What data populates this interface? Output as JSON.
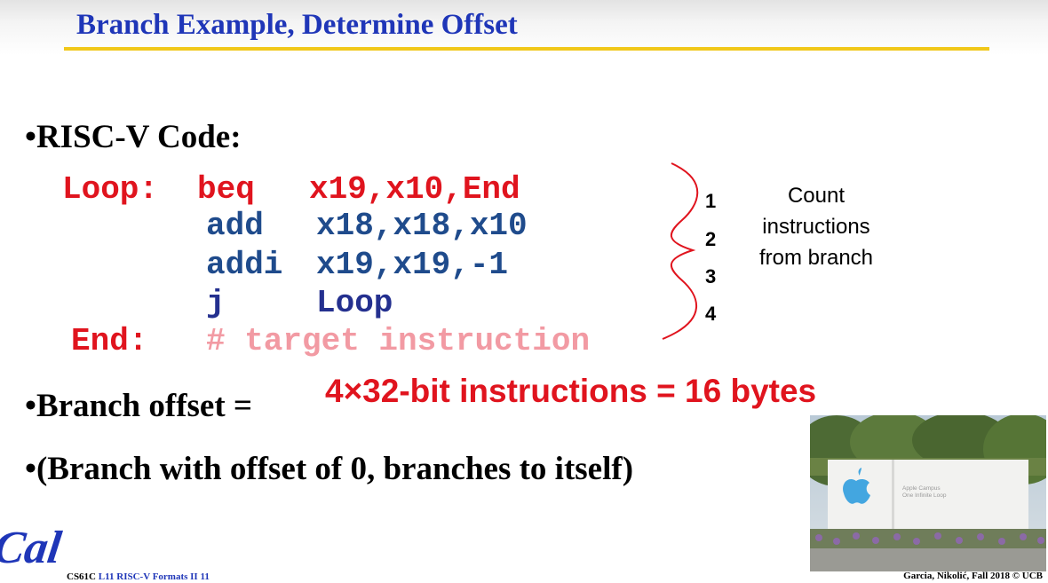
{
  "title": "Branch Example, Determine Offset",
  "bullets": {
    "code_heading": "•RISC-V Code:",
    "offset_label": "•Branch offset =",
    "zero_offset": "•(Branch with offset of 0, branches to itself)"
  },
  "code": {
    "line1_label": "Loop:",
    "line1_op": "beq",
    "line1_args": "x19,x10,End",
    "line2_op": "add",
    "line2_args": "x18,x18,x10",
    "line3_op": "addi",
    "line3_args": "x19,x19,-1",
    "line4_op": "j",
    "line4_args": "Loop",
    "line5_label": "End:",
    "line5_comment": "# target instruction"
  },
  "count_numbers": [
    "1",
    "2",
    "3",
    "4"
  ],
  "count_note": [
    "Count",
    "instructions",
    "from branch"
  ],
  "offset_value": "4×32-bit instructions = 16 bytes",
  "photo_sign": [
    "Apple Campus",
    "One Infinite Loop"
  ],
  "logo_text": "Cal",
  "footer": {
    "course": "CS61C",
    "lecture": "L11 RISC-V Formats II 11",
    "credit": "Garcia, Nikolić, Fall 2018 © UCB"
  },
  "colors": {
    "title": "#1f36b8",
    "rule": "#f1c81a",
    "code_red": "#e0141e",
    "code_blue": "#1f4b8c",
    "comment_pink": "#f29aa3"
  }
}
